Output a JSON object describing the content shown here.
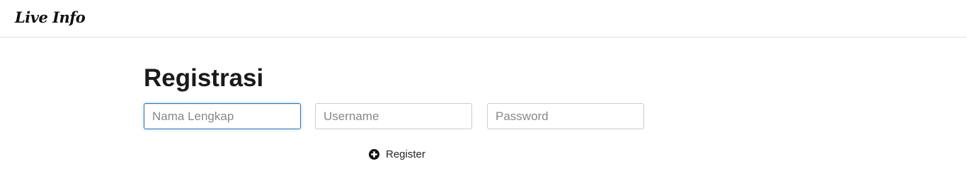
{
  "navbar": {
    "brand": "Live Info"
  },
  "page": {
    "title": "Registrasi"
  },
  "form": {
    "nama": {
      "placeholder": "Nama Lengkap",
      "value": ""
    },
    "username": {
      "placeholder": "Username",
      "value": ""
    },
    "password": {
      "placeholder": "Password",
      "value": ""
    },
    "register_label": "Register",
    "register_icon": "plus-circle-icon"
  },
  "colors": {
    "focus_border": "#2a74b5",
    "field_border": "#cccccc"
  }
}
